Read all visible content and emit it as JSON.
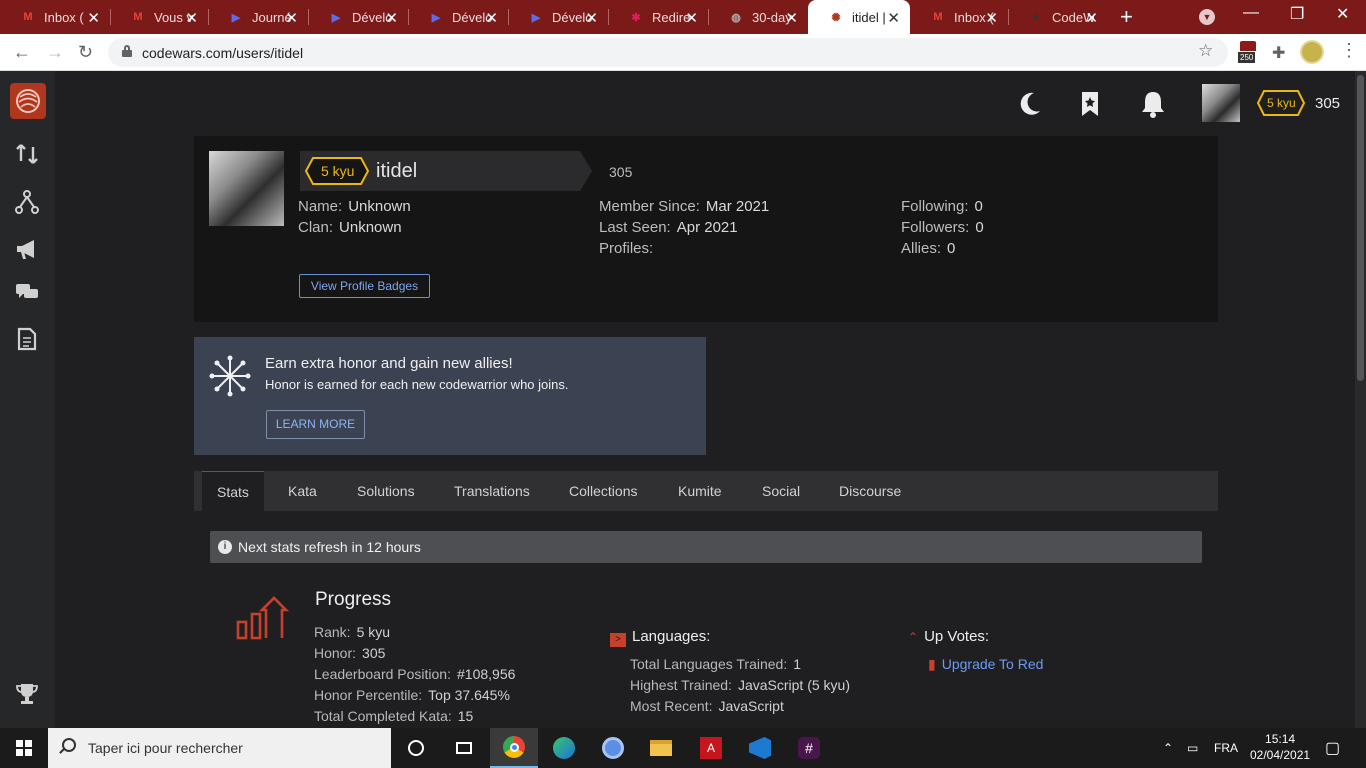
{
  "browser": {
    "tabs": [
      {
        "label": "Inbox (",
        "icon": "gmail-icon",
        "color": "#ea4335"
      },
      {
        "label": "Vous v",
        "icon": "gmail-icon",
        "color": "#ea4335"
      },
      {
        "label": "Journé",
        "icon": "play-icon",
        "color": "#5b6ee8"
      },
      {
        "label": "Dévelo",
        "icon": "play-icon",
        "color": "#5b6ee8"
      },
      {
        "label": "Dévelo",
        "icon": "play-icon",
        "color": "#5b6ee8"
      },
      {
        "label": "Dévelo",
        "icon": "play-icon",
        "color": "#5b6ee8"
      },
      {
        "label": "Redire",
        "icon": "slack-icon",
        "color": "#e01e5a"
      },
      {
        "label": "30-day",
        "icon": "globe-icon",
        "color": "#888888"
      },
      {
        "label": "itidel |",
        "icon": "codewars-icon",
        "color": "#b1361e"
      },
      {
        "label": "Inbox (",
        "icon": "gmail-icon",
        "color": "#ea4335"
      },
      {
        "label": "CodeW",
        "icon": "github-icon",
        "color": "#333333"
      }
    ],
    "active_tab_index": 8,
    "url": "codewars.com/users/itidel",
    "ext_badge": "250"
  },
  "header": {
    "rank": "5 kyu",
    "honor": "305"
  },
  "profile": {
    "rank": "5 kyu",
    "username": "itidel",
    "honor": "305",
    "name_label": "Name:",
    "name_value": "Unknown",
    "clan_label": "Clan:",
    "clan_value": "Unknown",
    "member_since_label": "Member Since:",
    "member_since_value": "Mar 2021",
    "last_seen_label": "Last Seen:",
    "last_seen_value": "Apr 2021",
    "profiles_label": "Profiles:",
    "following_label": "Following:",
    "following_value": "0",
    "followers_label": "Followers:",
    "followers_value": "0",
    "allies_label": "Allies:",
    "allies_value": "0",
    "badges_button": "View Profile Badges"
  },
  "promo": {
    "title": "Earn extra honor and gain new allies!",
    "subtitle": "Honor is earned for each new codewarrior who joins.",
    "button": "LEARN MORE"
  },
  "profile_tabs": [
    "Stats",
    "Kata",
    "Solutions",
    "Translations",
    "Collections",
    "Kumite",
    "Social",
    "Discourse"
  ],
  "stats": {
    "notice": "Next stats refresh in 12 hours",
    "progress_title": "Progress",
    "rank_label": "Rank:",
    "rank_value": "5 kyu",
    "honor_label": "Honor:",
    "honor_value": "305",
    "leaderboard_label": "Leaderboard Position:",
    "leaderboard_value": "#108,956",
    "percentile_label": "Honor Percentile:",
    "percentile_value": "Top 37.645%",
    "completed_label": "Total Completed Kata:",
    "completed_value": "15",
    "languages_title": "Languages:",
    "lang_trained_label": "Total Languages Trained:",
    "lang_trained_value": "1",
    "highest_label": "Highest Trained:",
    "highest_value": "JavaScript (5 kyu)",
    "recent_label": "Most Recent:",
    "recent_value": "JavaScript",
    "upvotes_title": "Up Votes:",
    "upgrade_link": "Upgrade To Red"
  },
  "taskbar": {
    "search_placeholder": "Taper ici pour rechercher",
    "language": "FRA",
    "time": "15:14",
    "date": "02/04/2021"
  },
  "colors": {
    "accent": "#b1361e",
    "rank_yellow": "#ecb613",
    "link": "#6a9bf4"
  }
}
